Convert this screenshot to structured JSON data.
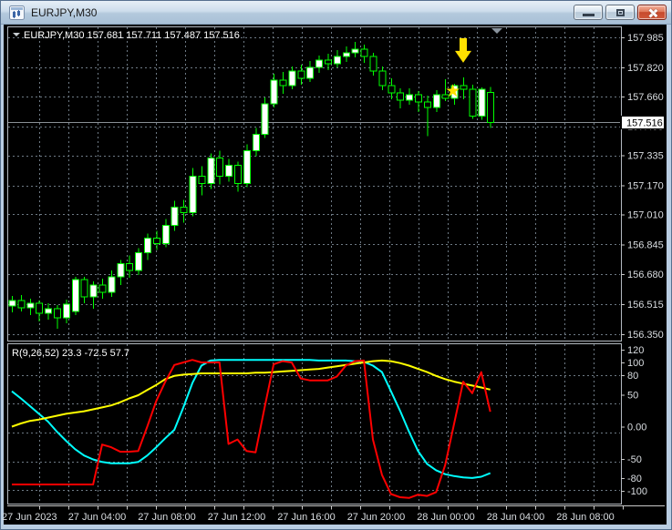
{
  "window": {
    "title": "EURJPY,M30",
    "controls": [
      {
        "name": "minimize"
      },
      {
        "name": "maximize"
      },
      {
        "name": "close"
      }
    ]
  },
  "chart": {
    "symbol_header": "EURJPY,M30 157.681 157.711 157.487 157.516",
    "indicator_header": "R(9,26,52) 23.3 -72.5 57.7",
    "current_price": "157.516",
    "ohlc": {
      "open": "157.681",
      "high": "157.711",
      "low": "157.487",
      "close": "157.516"
    }
  },
  "colors": {
    "background": "#000000",
    "grid": "#6e7a85",
    "candle_outline": "#00ff00",
    "bull_fill": "#ffffff",
    "bear_fill": "#000000",
    "price_line": "#8a9096",
    "axis_text": "#d9dde1",
    "annotation": "#ffe000",
    "current_price_box_bg": "#ffffff",
    "current_price_box_text": "#000000"
  },
  "chart_data": [
    {
      "type": "candlestick",
      "symbol": "EURJPY",
      "timeframe": "M30",
      "header": "EURJPY,M30 157.681 157.711 157.487 157.516",
      "y_ticks": [
        "157.985",
        "157.820",
        "157.660",
        "157.495",
        "157.335",
        "157.170",
        "157.010",
        "156.845",
        "156.680",
        "156.515",
        "156.350"
      ],
      "y_tick_values": [
        157.985,
        157.82,
        157.66,
        157.495,
        157.335,
        157.17,
        157.01,
        156.845,
        156.68,
        156.515,
        156.35
      ],
      "x_labels": [
        "27 Jun 2023",
        "27 Jun 04:00",
        "27 Jun 08:00",
        "27 Jun 12:00",
        "27 Jun 16:00",
        "27 Jun 20:00",
        "28 Jun 00:00",
        "28 Jun 04:00",
        "28 Jun 08:00"
      ],
      "current_price": 157.516,
      "candles": [
        [
          156.505,
          156.56,
          156.47,
          156.535
        ],
        [
          156.535,
          156.565,
          156.475,
          156.495
        ],
        [
          156.495,
          156.545,
          156.455,
          156.52
        ],
        [
          156.52,
          156.535,
          156.42,
          156.465
        ],
        [
          156.465,
          156.52,
          156.43,
          156.49
        ],
        [
          156.49,
          156.51,
          156.38,
          156.44
        ],
        [
          156.44,
          156.54,
          156.41,
          156.515
        ],
        [
          156.475,
          156.665,
          156.455,
          156.65
        ],
        [
          156.65,
          156.665,
          156.52,
          156.555
        ],
        [
          156.555,
          156.64,
          156.49,
          156.62
        ],
        [
          156.62,
          156.655,
          156.545,
          156.58
        ],
        [
          156.58,
          156.7,
          156.555,
          156.665
        ],
        [
          156.665,
          156.76,
          156.62,
          156.74
        ],
        [
          156.74,
          156.785,
          156.66,
          156.7
        ],
        [
          156.7,
          156.825,
          156.675,
          156.8
        ],
        [
          156.8,
          156.905,
          156.76,
          156.88
        ],
        [
          156.88,
          156.92,
          156.815,
          156.85
        ],
        [
          156.85,
          156.985,
          156.83,
          156.95
        ],
        [
          156.95,
          157.085,
          156.92,
          157.05
        ],
        [
          157.05,
          157.09,
          156.965,
          157.02
        ],
        [
          157.02,
          157.265,
          157.0,
          157.22
        ],
        [
          157.22,
          157.275,
          157.115,
          157.18
        ],
        [
          157.18,
          157.345,
          157.15,
          157.32
        ],
        [
          157.32,
          157.36,
          157.175,
          157.22
        ],
        [
          157.22,
          157.315,
          157.19,
          157.28
        ],
        [
          157.28,
          157.3,
          157.135,
          157.18
        ],
        [
          157.18,
          157.395,
          157.16,
          157.36
        ],
        [
          157.36,
          157.485,
          157.33,
          157.45
        ],
        [
          157.45,
          157.655,
          157.43,
          157.62
        ],
        [
          157.62,
          157.785,
          157.6,
          157.75
        ],
        [
          157.75,
          157.795,
          157.675,
          157.72
        ],
        [
          157.72,
          157.825,
          157.7,
          157.8
        ],
        [
          157.8,
          157.835,
          157.725,
          157.76
        ],
        [
          157.76,
          157.855,
          157.74,
          157.82
        ],
        [
          157.82,
          157.885,
          157.79,
          157.86
        ],
        [
          157.86,
          157.895,
          157.805,
          157.84
        ],
        [
          157.84,
          157.915,
          157.82,
          157.88
        ],
        [
          157.88,
          157.935,
          157.85,
          157.9
        ],
        [
          157.9,
          157.96,
          157.875,
          157.92
        ],
        [
          157.92,
          157.945,
          157.845,
          157.88
        ],
        [
          157.88,
          157.9,
          157.775,
          157.8
        ],
        [
          157.8,
          157.825,
          157.695,
          157.72
        ],
        [
          157.72,
          157.76,
          157.645,
          157.68
        ],
        [
          157.68,
          157.705,
          157.595,
          157.64
        ],
        [
          157.64,
          157.705,
          157.615,
          157.67
        ],
        [
          157.67,
          157.69,
          157.575,
          157.63
        ],
        [
          157.63,
          157.665,
          157.44,
          157.6
        ],
        [
          157.6,
          157.695,
          157.575,
          157.67
        ],
        [
          157.67,
          157.755,
          157.635,
          157.65
        ],
        [
          157.65,
          157.73,
          157.615,
          157.72
        ],
        [
          157.72,
          157.765,
          157.645,
          157.7
        ],
        [
          157.7,
          157.725,
          157.535,
          157.55
        ],
        [
          157.55,
          157.71,
          157.53,
          157.7
        ],
        [
          157.681,
          157.711,
          157.487,
          157.516
        ]
      ],
      "annotations": [
        {
          "type": "star",
          "glyph": "★",
          "candle_index": 49,
          "price": 157.73,
          "color": "#ffe000"
        },
        {
          "type": "arrow-down",
          "candle_index": 50,
          "price": 157.86,
          "color": "#ffe000"
        }
      ]
    },
    {
      "type": "line",
      "indicator": "R(9,26,52)",
      "header": "R(9,26,52) 23.3 -72.5 57.7",
      "current_values": [
        23.3,
        -72.5,
        57.7
      ],
      "y_ticks": [
        "120",
        "100",
        "80",
        "50",
        "0.00",
        "-50",
        "-80",
        "-100"
      ],
      "y_tick_values": [
        120,
        100,
        80,
        50,
        0,
        -50,
        -80,
        -100
      ],
      "series": [
        {
          "name": "R9",
          "color": "#ff0000",
          "values": [
            -90,
            -90,
            -90,
            -90,
            -90,
            -90,
            -90,
            -90,
            -90,
            -90,
            -28,
            -32,
            -39,
            -39,
            -38,
            0,
            40,
            70,
            96,
            100,
            104,
            100,
            100,
            100,
            -27,
            -20,
            -38,
            -40,
            30,
            97,
            102,
            100,
            75,
            72,
            72,
            72,
            78,
            95,
            102,
            103,
            -20,
            -75,
            -105,
            -110,
            -111,
            -106,
            -108,
            -102,
            -60,
            5,
            70,
            52,
            85,
            23.3
          ]
        },
        {
          "name": "R26",
          "color": "#00ffff",
          "values": [
            55,
            44,
            32,
            20,
            8,
            -8,
            -22,
            -35,
            -45,
            -51,
            -55,
            -57,
            -57,
            -57,
            -55,
            -45,
            -32,
            -18,
            -5,
            30,
            68,
            95,
            103,
            104,
            104,
            104,
            104,
            104,
            104,
            104,
            104,
            104,
            104,
            104,
            103,
            103,
            103,
            103,
            102,
            101,
            95,
            85,
            55,
            25,
            -8,
            -38,
            -58,
            -68,
            -74,
            -77,
            -79,
            -80,
            -78,
            -72.5
          ]
        },
        {
          "name": "R52",
          "color": "#ffff00",
          "values": [
            0,
            5,
            9,
            11,
            14,
            17,
            20,
            22,
            24,
            27,
            30,
            33,
            38,
            44,
            49,
            57,
            65,
            74,
            79,
            81,
            82,
            83,
            83,
            83,
            83,
            83,
            83,
            84,
            84,
            85,
            86,
            87,
            88,
            89,
            90,
            92,
            94,
            96,
            98,
            100,
            102,
            103,
            102,
            99,
            95,
            90,
            85,
            79,
            74,
            70,
            67,
            64,
            61,
            57.7
          ]
        }
      ]
    }
  ]
}
